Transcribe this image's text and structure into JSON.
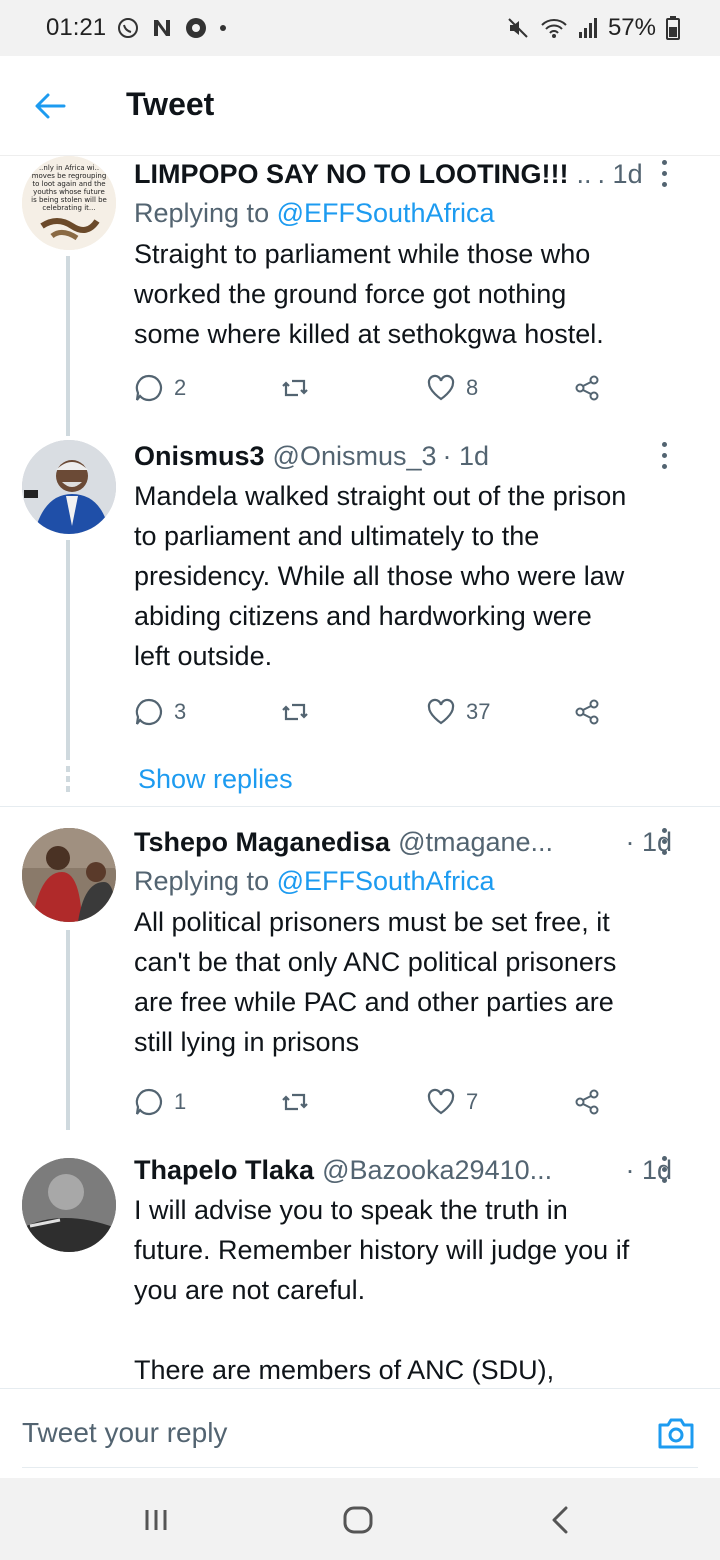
{
  "status_bar": {
    "time": "01:21",
    "battery": "57%",
    "left_icons": [
      "whatsapp-icon",
      "n-icon",
      "chrome-icon",
      "dot"
    ],
    "right_icons": [
      "mute-icon",
      "wifi-icon",
      "signal-icon",
      "battery-icon"
    ]
  },
  "app_bar": {
    "title": "Tweet",
    "back_icon": "back-arrow-icon"
  },
  "tweets": [
    {
      "name": "LIMPOPO SAY NO TO LOOTING!!!",
      "handle": "..",
      "time": ". 1d",
      "replying_prefix": "Replying to ",
      "replying_to": "@EFFSouthAfrica",
      "text": "Straight to parliament while those who\nworked the ground force got nothing\nsome where killed at sethokgwa hostel.",
      "replies": "2",
      "retweets": "",
      "likes": "8",
      "avatar_caption": "..nly in Africa wi..\nmoves be regrouping\nto loot again and the\nyouths whose future\nis being stolen will be\ncelebrating it..."
    },
    {
      "name": "Onismus3",
      "handle": "@Onismus_3",
      "time": "· 1d",
      "text": "Mandela walked straight out of the prison\nto parliament and ultimately to the\npresidency. While all those who were law\nabiding citizens and hardworking were\nleft outside.",
      "replies": "3",
      "retweets": "",
      "likes": "37"
    },
    {
      "name": "Tshepo Maganedisa",
      "handle": "@tmagane...",
      "time": "· 1d",
      "replying_prefix": "Replying to ",
      "replying_to": "@EFFSouthAfrica",
      "text": "All political prisoners must be set free, it\ncan't be that only ANC political prisoners\nare free while PAC and other parties are\nstill lying in prisons",
      "replies": "1",
      "retweets": "",
      "likes": "7"
    },
    {
      "name": "Thapelo Tlaka",
      "handle": "@Bazooka29410...",
      "time": "· 1d",
      "text": "I will advise you to speak the truth in\nfuture. Remember history will judge you if\nyou are not careful.\n\nThere are members of ANC (SDU),"
    }
  ],
  "show_replies": "Show replies",
  "reply_bar": {
    "placeholder": "Tweet your reply",
    "camera_icon": "camera-icon"
  },
  "nav_bar": {
    "icons": [
      "recents-icon",
      "home-icon",
      "back-icon"
    ]
  },
  "colors": {
    "accent": "#1d9bf0",
    "secondary_text": "#536471",
    "divider": "#e6ecf0"
  }
}
